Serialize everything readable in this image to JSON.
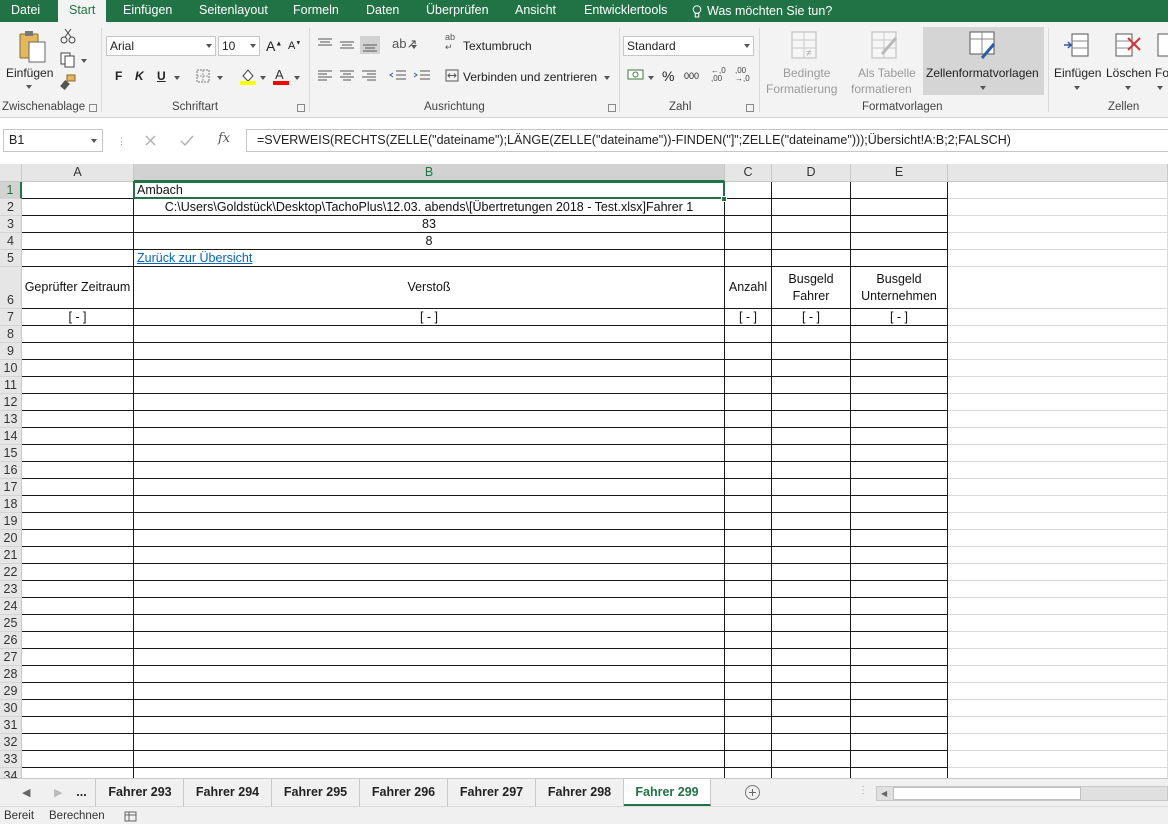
{
  "tabs": [
    "Datei",
    "Start",
    "Einfügen",
    "Seitenlayout",
    "Formeln",
    "Daten",
    "Überprüfen",
    "Ansicht",
    "Entwicklertools"
  ],
  "tell_me": "Was möchten Sie tun?",
  "ribbon": {
    "clipboard": {
      "paste": "Einfügen",
      "label": "Zwischenablage"
    },
    "font": {
      "name": "Arial",
      "size": "10",
      "bold": "F",
      "italic": "K",
      "underline": "U",
      "label": "Schriftart"
    },
    "alignment": {
      "wrap": "Textumbruch",
      "merge": "Verbinden und zentrieren",
      "label": "Ausrichtung"
    },
    "number": {
      "format": "Standard",
      "percent": "%",
      "thousands": "000",
      "label": "Zahl"
    },
    "styles": {
      "conditional_1": "Bedingte",
      "conditional_2": "Formatierung",
      "table_1": "Als Tabelle",
      "table_2": "formatieren",
      "cell_styles": "Zellenformatvorlagen",
      "label": "Formatvorlagen"
    },
    "cells": {
      "insert": "Einfügen",
      "delete": "Löschen",
      "format": "Fo",
      "label": "Zellen"
    }
  },
  "formula_bar": {
    "name_box": "B1",
    "fx": "fx",
    "formula": "=SVERWEIS(RECHTS(ZELLE(\"dateiname\");LÄNGE(ZELLE(\"dateiname\"))-FINDEN(\"]\";ZELLE(\"dateiname\")));Übersicht!A:B;2;FALSCH)"
  },
  "columns": [
    "A",
    "B",
    "C",
    "D",
    "E"
  ],
  "rows": [
    "1",
    "2",
    "3",
    "4",
    "5",
    "6",
    "7",
    "8",
    "9",
    "10",
    "11",
    "12",
    "13",
    "14",
    "15",
    "16",
    "17",
    "18",
    "19",
    "20",
    "21",
    "22",
    "23",
    "24",
    "25",
    "26",
    "27",
    "28",
    "29",
    "30",
    "31",
    "32",
    "33",
    "34"
  ],
  "cells": {
    "b1": "Ambach",
    "b2": "C:\\Users\\Goldstück\\Desktop\\TachoPlus\\12.03. abends\\[Übertretungen 2018 - Test.xlsx]Fahrer 1",
    "b3": "83",
    "b4": "8",
    "b5": "Zurück zur Übersicht",
    "a6": "Geprüfter Zeitraum",
    "b6": "Verstoß",
    "c6": "Anzahl",
    "d6": "Busgeld Fahrer",
    "e6": "Busgeld Unternehmen",
    "a7": "[ - ]",
    "b7": "[ - ]",
    "c7": "[ - ]",
    "d7": "[ - ]",
    "e7": "[ - ]"
  },
  "sheets": [
    "...",
    "Fahrer 293",
    "Fahrer 294",
    "Fahrer 295",
    "Fahrer 296",
    "Fahrer 297",
    "Fahrer 298",
    "Fahrer 299"
  ],
  "active_sheet": "Fahrer 299",
  "status": {
    "ready": "Bereit",
    "calc": "Berechnen"
  },
  "colors": {
    "accent": "#217346",
    "link": "#0563c1"
  }
}
